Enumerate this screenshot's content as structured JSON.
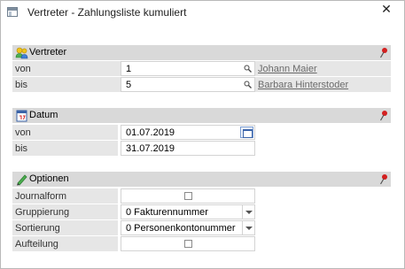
{
  "window": {
    "title": "Vertreter - Zahlungsliste kumuliert",
    "close_label": "✕"
  },
  "sections": {
    "vertreter": {
      "title": "Vertreter",
      "von_label": "von",
      "von_value": "1",
      "von_name": "Johann Maier",
      "bis_label": "bis",
      "bis_value": "5",
      "bis_name": "Barbara Hinterstoder"
    },
    "datum": {
      "title": "Datum",
      "von_label": "von",
      "von_value": "01.07.2019",
      "bis_label": "bis",
      "bis_value": "31.07.2019"
    },
    "optionen": {
      "title": "Optionen",
      "journalform_label": "Journalform",
      "journalform_checked": false,
      "gruppierung_label": "Gruppierung",
      "gruppierung_value": "0 Fakturennummer",
      "sortierung_label": "Sortierung",
      "sortierung_value": "0 Personenkontonummer",
      "aufteilung_label": "Aufteilung",
      "aufteilung_checked": false
    }
  },
  "icons": {
    "app": "window-icon",
    "vertreter": "users-icon",
    "datum": "calendar-icon",
    "optionen": "pencil-icon",
    "pin": "pin-icon",
    "search": "search-icon",
    "calendar_button": "calendar-icon",
    "dropdown": "chevron-down-icon"
  },
  "colors": {
    "section_header_bg": "#d9d9d9",
    "row_bg": "#e6e6e6",
    "pin_red": "#d32020",
    "link_gray": "#6b6b6b",
    "calendar_blue": "#3a63a8"
  }
}
